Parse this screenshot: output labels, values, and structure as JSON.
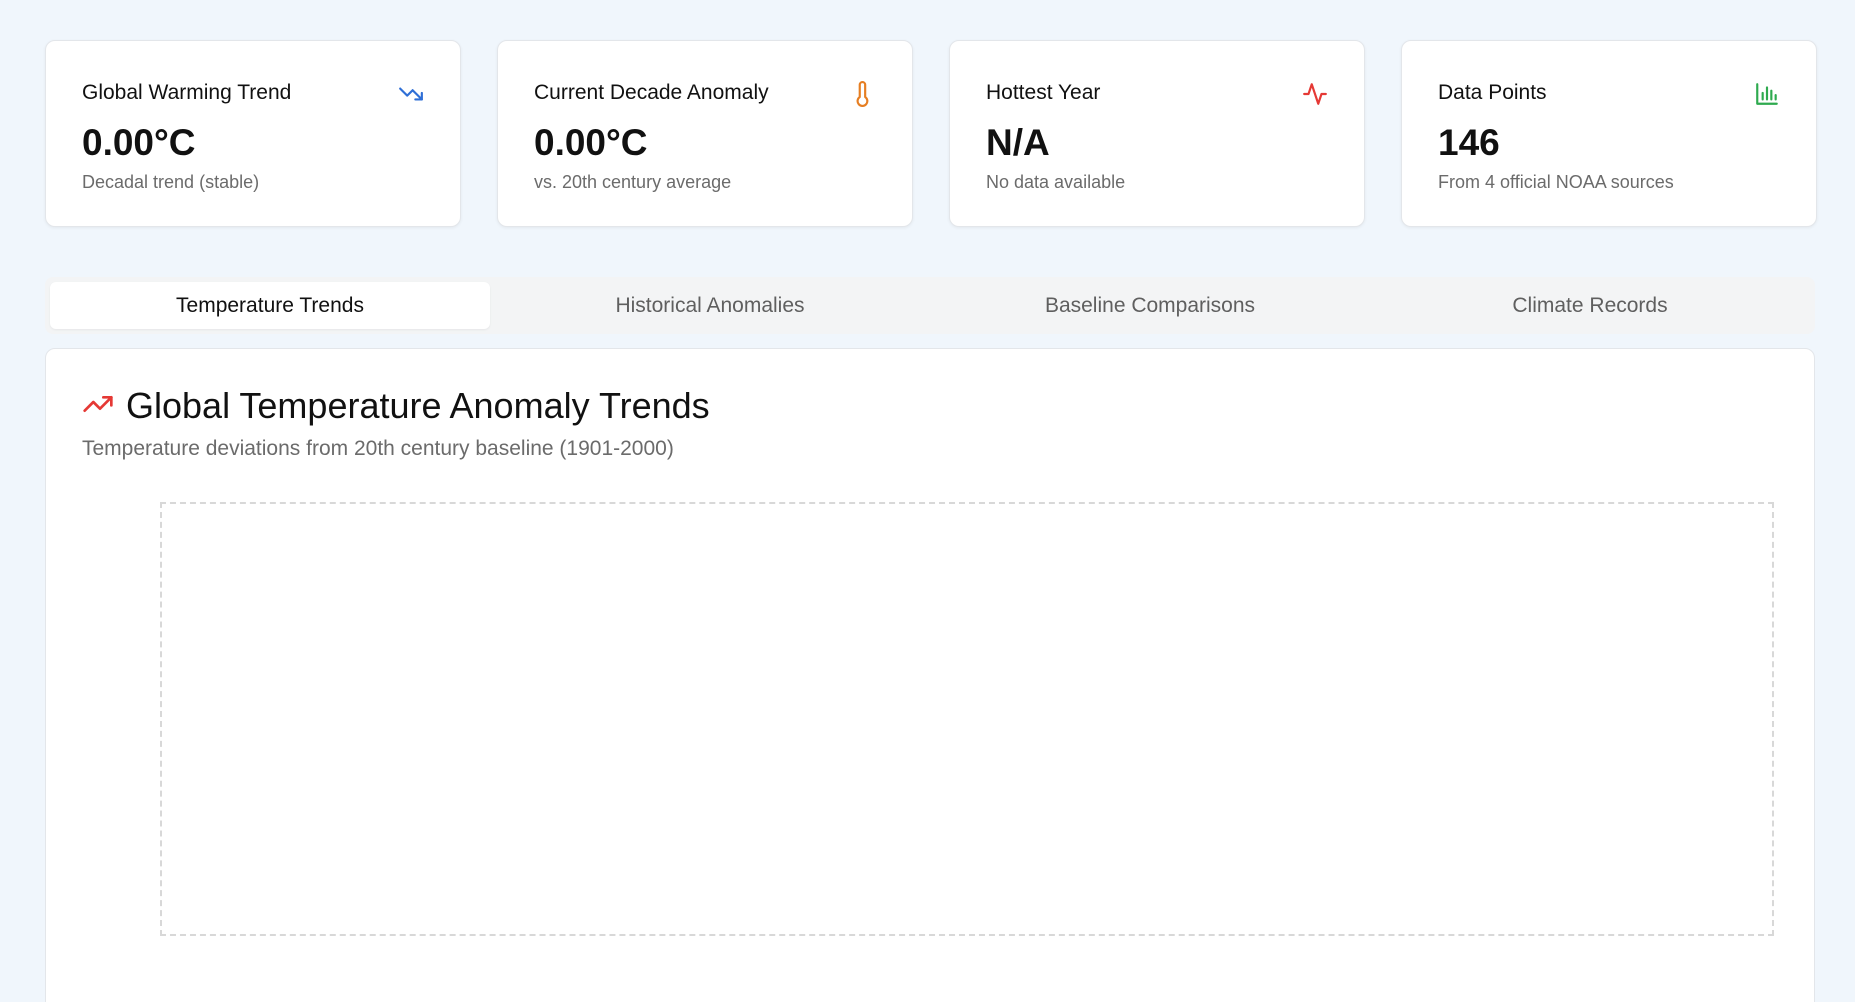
{
  "stats": [
    {
      "title": "Global Warming Trend",
      "value": "0.00°C",
      "subtitle": "Decadal trend (stable)",
      "icon": "trending-down-icon",
      "icon_color": "#2f6fd6"
    },
    {
      "title": "Current Decade Anomaly",
      "value": "0.00°C",
      "subtitle": "vs. 20th century average",
      "icon": "thermometer-icon",
      "icon_color": "#e67e22"
    },
    {
      "title": "Hottest Year",
      "value": "N/A",
      "subtitle": "No data available",
      "icon": "activity-icon",
      "icon_color": "#e53935"
    },
    {
      "title": "Data Points",
      "value": "146",
      "subtitle": "From 4 official NOAA sources",
      "icon": "bar-chart-icon",
      "icon_color": "#2eaa4f"
    }
  ],
  "tabs": [
    {
      "label": "Temperature Trends",
      "active": true
    },
    {
      "label": "Historical Anomalies",
      "active": false
    },
    {
      "label": "Baseline Comparisons",
      "active": false
    },
    {
      "label": "Climate Records",
      "active": false
    }
  ],
  "panel": {
    "title": "Global Temperature Anomaly Trends",
    "subtitle": "Temperature deviations from 20th century baseline (1901-2000)",
    "icon": "trending-up-icon",
    "icon_color": "#e53935"
  }
}
